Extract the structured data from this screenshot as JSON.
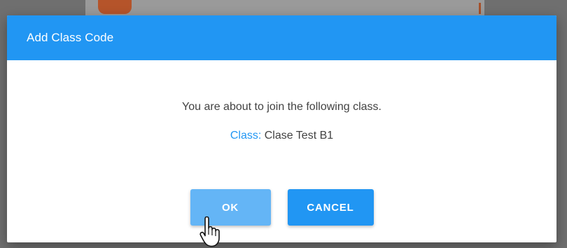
{
  "dialog": {
    "title": "Add Class Code",
    "message": "You are about to join the following class.",
    "class_label": "Class:",
    "class_value": "Clase Test B1",
    "ok_label": "OK",
    "cancel_label": "CANCEL"
  },
  "colors": {
    "header": "#2196f3",
    "accent": "#2196f3",
    "ok_button": "#64b5f6",
    "cancel_button": "#2196f3"
  },
  "icons": {
    "cursor": "pointer-hand-icon"
  }
}
